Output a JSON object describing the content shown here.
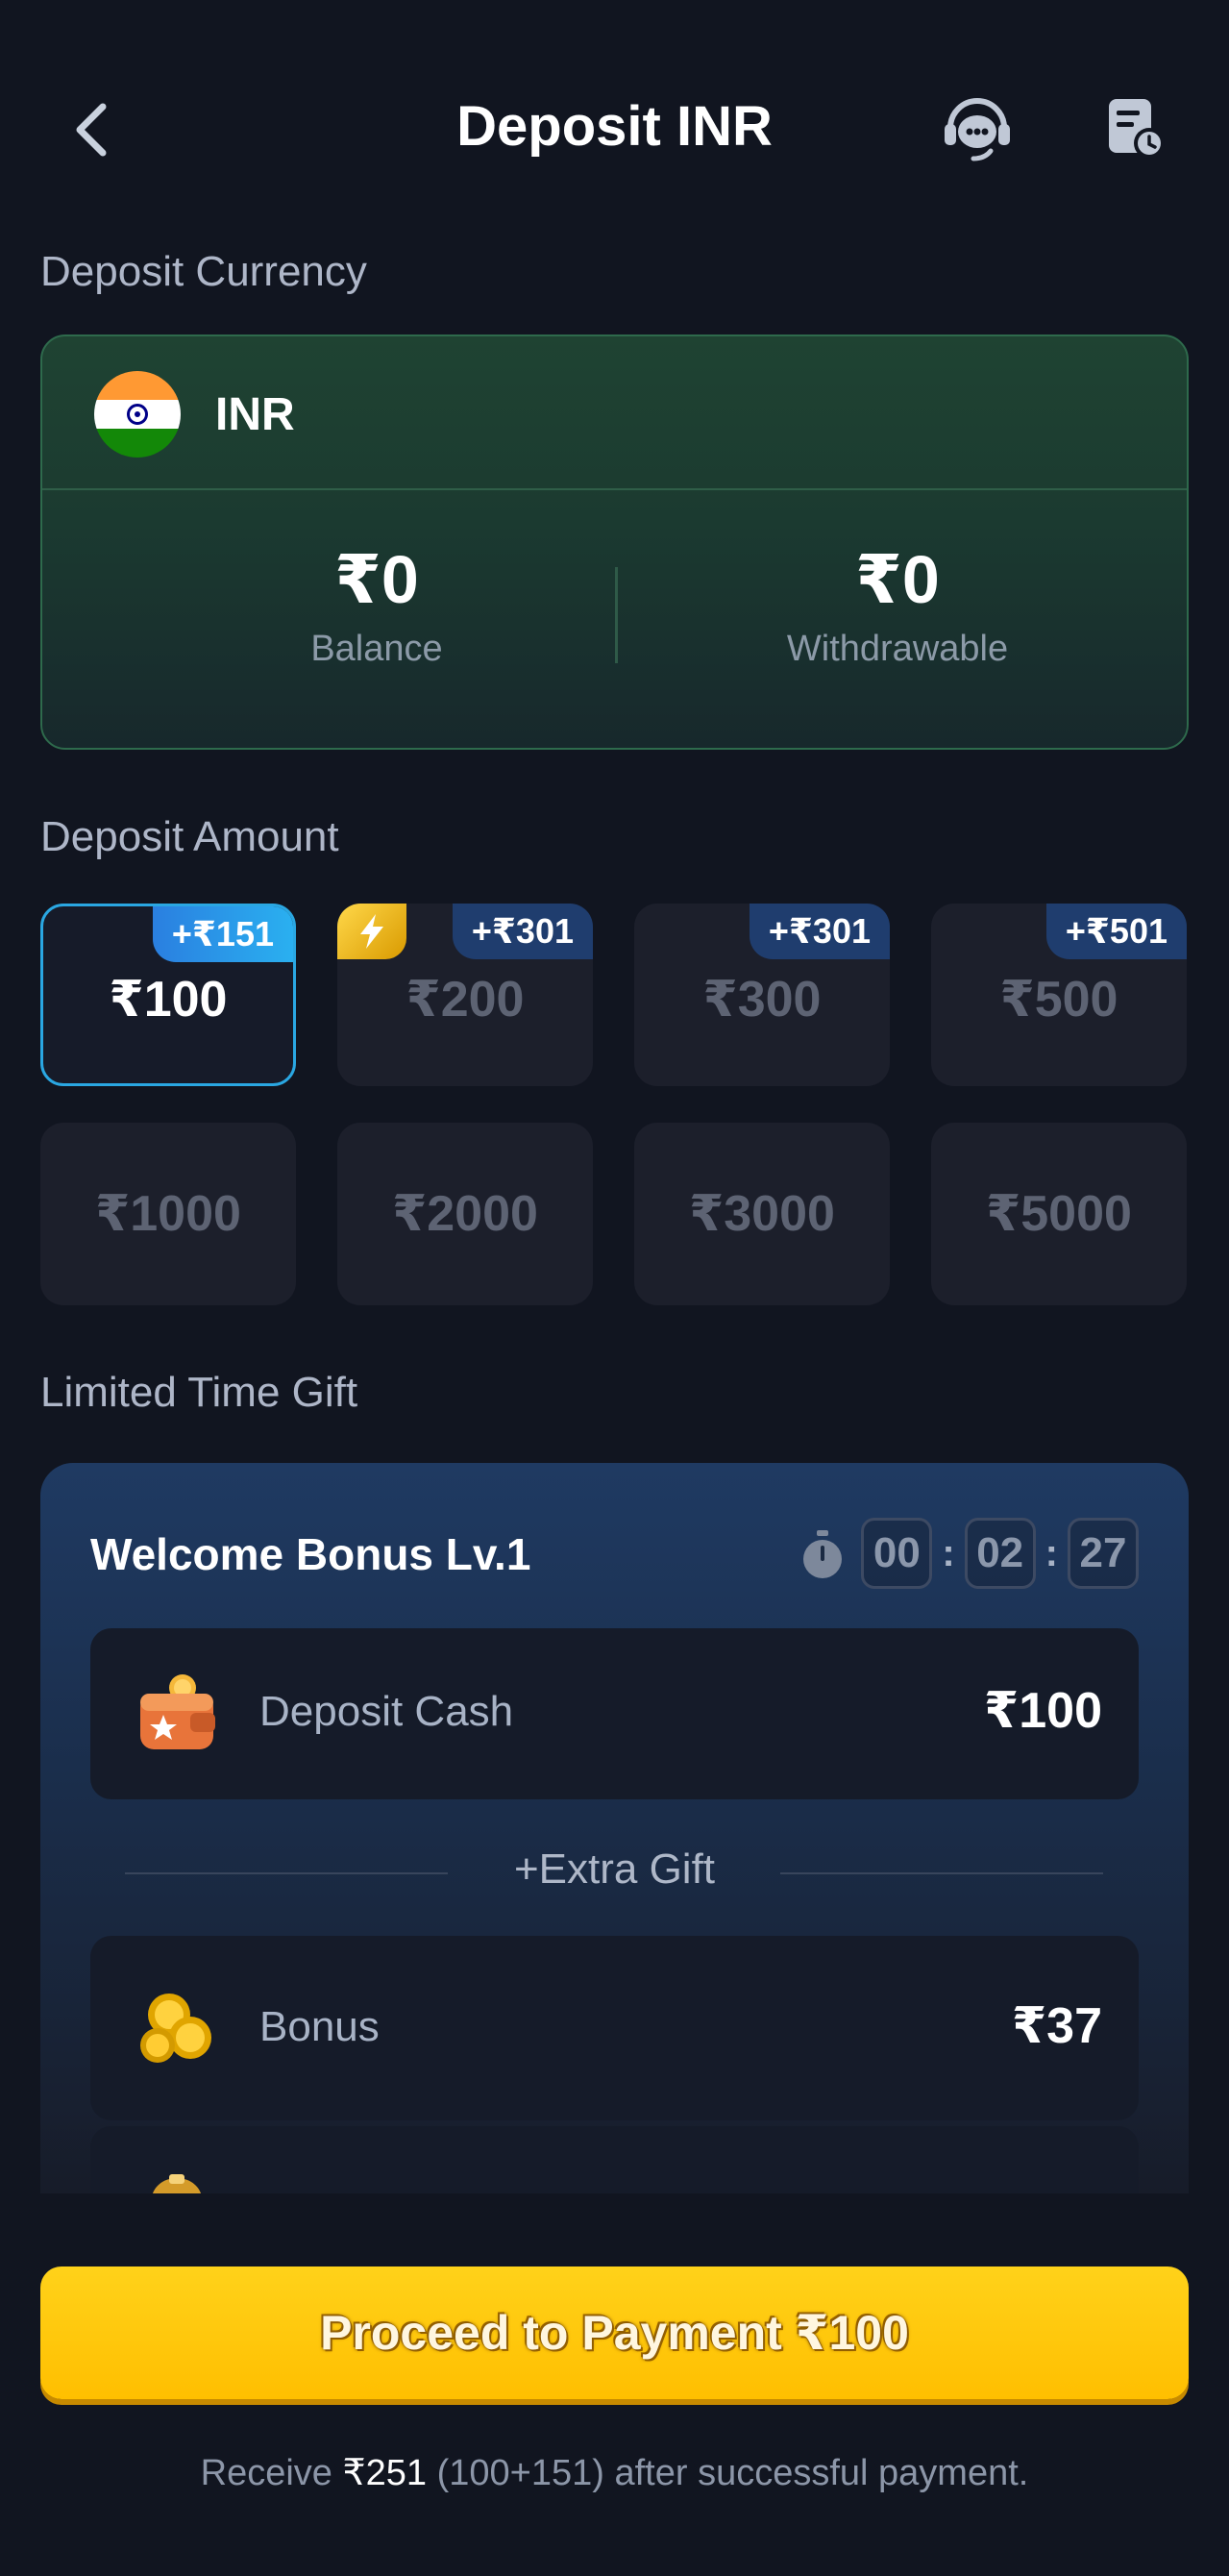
{
  "header": {
    "title": "Deposit INR"
  },
  "currency_section": {
    "label": "Deposit Currency",
    "currency": "INR",
    "balance_value": "₹0",
    "balance_label": "Balance",
    "withdrawable_value": "₹0",
    "withdrawable_label": "Withdrawable"
  },
  "amount_section": {
    "label": "Deposit Amount",
    "amounts": [
      {
        "label": "₹100",
        "badge": "+₹151",
        "selected": true
      },
      {
        "label": "₹200",
        "badge": "+₹301",
        "flash": true
      },
      {
        "label": "₹300",
        "badge": "+₹301"
      },
      {
        "label": "₹500",
        "badge": "+₹501"
      },
      {
        "label": "₹1000"
      },
      {
        "label": "₹2000"
      },
      {
        "label": "₹3000"
      },
      {
        "label": "₹5000"
      }
    ]
  },
  "gift_section": {
    "label": "Limited Time Gift",
    "title": "Welcome Bonus Lv.1",
    "timer": {
      "hours": "00",
      "minutes": "02",
      "seconds": "27",
      "sep": ":"
    },
    "deposit_row": {
      "name": "Deposit Cash",
      "value": "₹100"
    },
    "extra_label": "+Extra Gift",
    "bonus_row": {
      "name": "Bonus",
      "value": "₹37"
    }
  },
  "footer": {
    "proceed_label": "Proceed to Payment ₹100",
    "note_prefix": "Receive ",
    "note_amount": "₹251",
    "note_suffix": " (100+151) after successful payment."
  },
  "colors": {
    "background": "#111520",
    "accent_yellow": "#ffc400",
    "selected_border": "#2aa7e2",
    "currency_card": "#1f4332"
  },
  "icons": [
    "back-arrow-icon",
    "support-chat-icon",
    "deposit-records-icon",
    "india-flag-icon",
    "lightning-icon",
    "stopwatch-icon",
    "wallet-icon",
    "gold-coins-icon",
    "treasure-icon"
  ]
}
